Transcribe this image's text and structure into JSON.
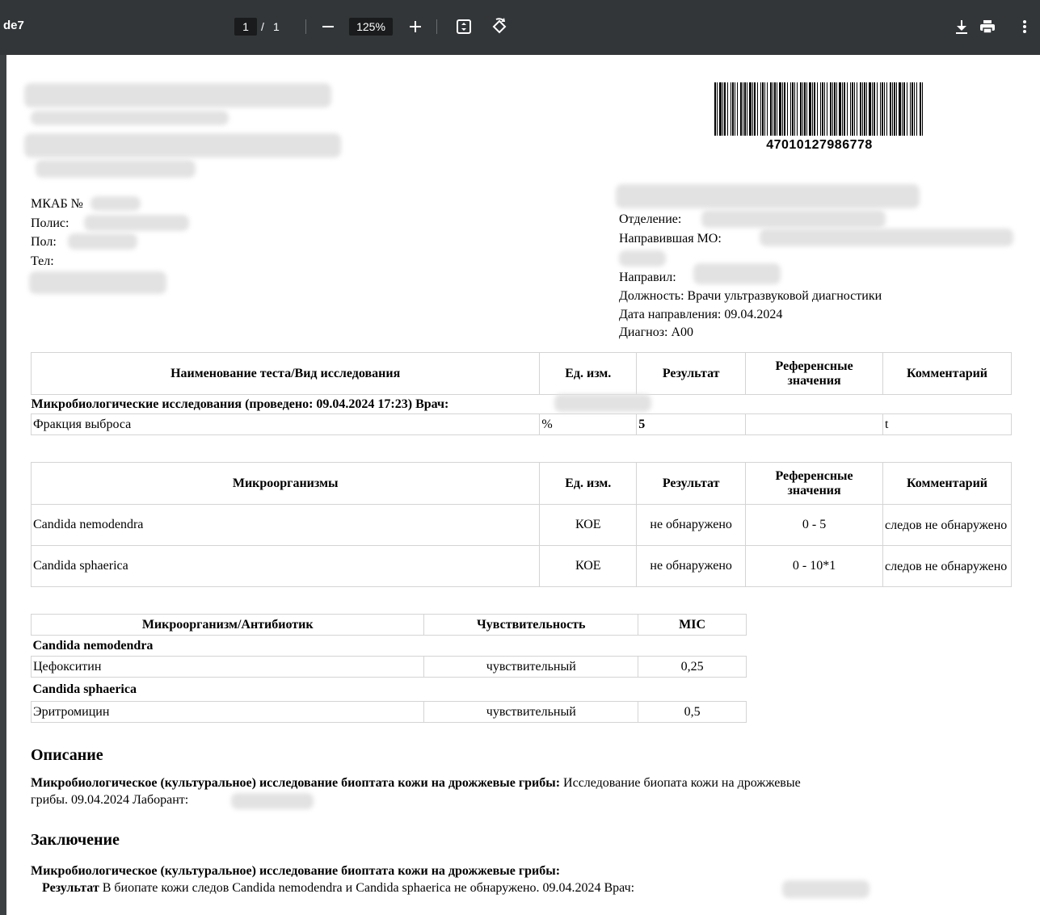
{
  "toolbar": {
    "doc_title": "de7",
    "page_current": "1",
    "page_sep": "/",
    "page_total": "1",
    "zoom": "125%",
    "icons": [
      "minus-icon",
      "plus-icon",
      "fit-page-icon",
      "rotate-icon",
      "download-icon",
      "print-icon",
      "more-vert-icon"
    ]
  },
  "barcode": {
    "number": "47010127986778"
  },
  "patient": {
    "mkab_label": "МКАБ №",
    "polis_label": "Полис:",
    "pol_label": "Пол:",
    "tel_label": "Тел:"
  },
  "referral": {
    "otdelenie_label": "Отделение:",
    "mo_label": "Направившая МО:",
    "napravil_label": "Направил:",
    "dolzhnost": "Должность: Врачи ультразвуковой диагностики",
    "data_napravleniya": "Дата направления: 09.04.2024",
    "diagnoz": "Диагноз: A00"
  },
  "table1": {
    "headers": [
      "Наименование теста/Вид исследования",
      "Ед. изм.",
      "Результат",
      "Референсные значения",
      "Комментарий"
    ],
    "section": "Микробиологические исследования (проведено: 09.04.2024 17:23) Врач:",
    "rows": [
      [
        "Фракция выброса",
        "%",
        "5",
        "",
        "t"
      ]
    ]
  },
  "table2": {
    "headers": [
      "Микроорганизмы",
      "Ед. изм.",
      "Результат",
      "Референсные значения",
      "Комментарий"
    ],
    "rows": [
      [
        "Candida nemodendra",
        "КОЕ",
        "не обнаружено",
        "0 - 5",
        "следов не обнаружено"
      ],
      [
        "Candida sphaerica",
        "КОЕ",
        "не обнаружено",
        "0 - 10*1",
        "следов не обнаружено"
      ]
    ]
  },
  "table3": {
    "headers": [
      "Микроорганизм/Антибиотик",
      "Чувствительность",
      "MIC"
    ],
    "groups": [
      {
        "name": "Candida nemodendra",
        "rows": [
          [
            "Цефокситин",
            "чувствительный",
            "0,25"
          ]
        ]
      },
      {
        "name": "Candida sphaerica",
        "rows": [
          [
            "Эритромицин",
            "чувствительный",
            "0,5"
          ]
        ]
      }
    ]
  },
  "description": {
    "heading": "Описание",
    "bold": "Микробиологическое (культуральное) исследование биоптата кожи на дрожжевые грибы:",
    "text1": " Исследование биопата кожи на дрожжевые",
    "text2": "грибы. 09.04.2024 Лаборант:",
    "tail": "."
  },
  "conclusion": {
    "heading": "Заключение",
    "bold": "Микробиологическое (культуральное) исследование биоптата кожи на дрожжевые грибы:",
    "result_label": "Результат",
    "result_text": " В биопате кожи следов Candida nemodendra и Candida sphaerica не обнаружено. 09.04.2024 Врач:"
  }
}
